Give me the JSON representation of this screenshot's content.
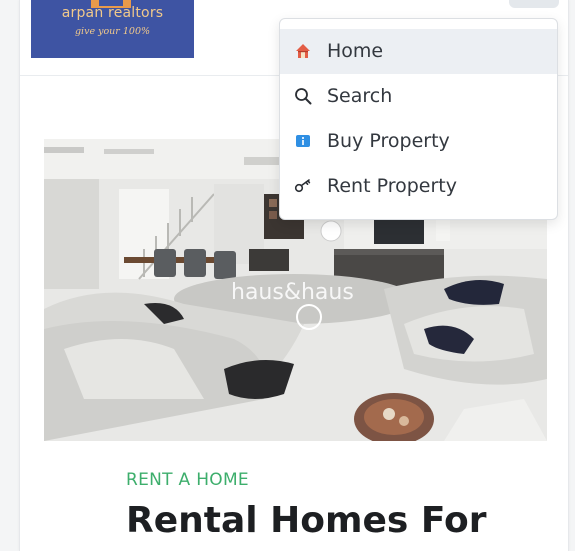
{
  "header": {
    "logo": {
      "brand": "arpan realtors",
      "tagline": "give your 100%"
    }
  },
  "menu": {
    "items": [
      {
        "label": "Home",
        "icon": "house-icon",
        "active": true
      },
      {
        "label": "Search",
        "icon": "search-icon",
        "active": false
      },
      {
        "label": "Buy Property",
        "icon": "info-icon",
        "active": false
      },
      {
        "label": "Rent Property",
        "icon": "key-icon",
        "active": false
      }
    ]
  },
  "hero": {
    "watermark": "haus&haus",
    "eyebrow": "RENT A HOME",
    "headline": "Rental Homes For"
  },
  "colors": {
    "logo_bg": "#3e54a3",
    "logo_text": "#f1c98b",
    "accent_green": "#3dae6c",
    "active_menu_bg": "#eceff3"
  }
}
